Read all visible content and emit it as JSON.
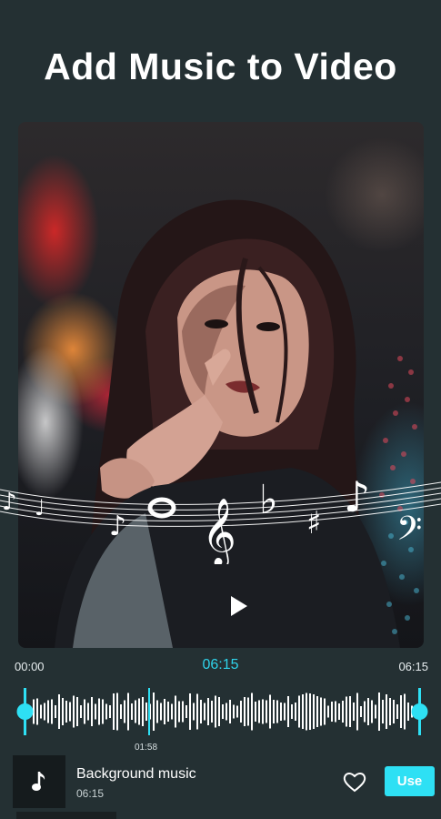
{
  "header": {
    "title": "Add Music to Video"
  },
  "player": {
    "start_time": "00:00",
    "current_time": "06:15",
    "end_time": "06:15",
    "marker_time": "01:58",
    "play_icon": "play-icon"
  },
  "track": {
    "title": "Background music",
    "duration": "06:15",
    "icon": "music-note-icon",
    "favorite_icon": "heart-outline-icon",
    "use_label": "Use"
  },
  "colors": {
    "accent": "#2ee0f4",
    "background": "#243033"
  }
}
